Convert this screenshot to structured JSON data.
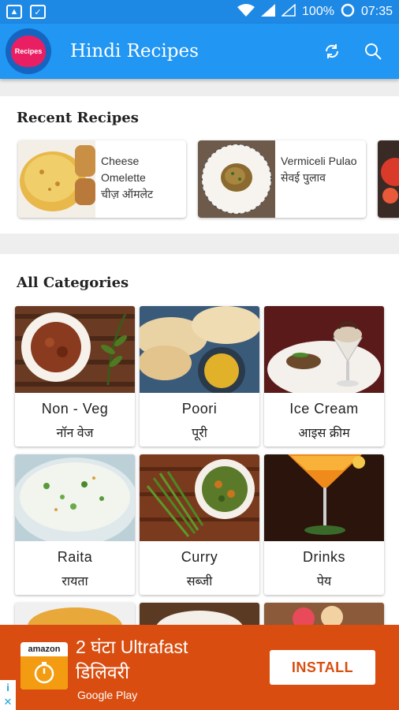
{
  "status_bar": {
    "battery": "100%",
    "time": "07:35"
  },
  "app_bar": {
    "title": "Hindi Recipes",
    "logo_text": "Recipes"
  },
  "recent": {
    "title": "Recent Recipes",
    "items": [
      {
        "name": "Cheese Omelette",
        "hindi": "चीज़ ऑमलेट"
      },
      {
        "name": "Vermiceli Pulao",
        "hindi": "सेवई पुलाव"
      }
    ]
  },
  "categories": {
    "title": "All Categories",
    "items": [
      {
        "name": "Non - Veg",
        "hindi": "नॉन वेज"
      },
      {
        "name": "Poori",
        "hindi": "पूरी"
      },
      {
        "name": "Ice Cream",
        "hindi": "आइस क्रीम"
      },
      {
        "name": "Raita",
        "hindi": "रायता"
      },
      {
        "name": "Curry",
        "hindi": "सब्जी"
      },
      {
        "name": "Drinks",
        "hindi": "पेय"
      }
    ]
  },
  "ad": {
    "brand": "amazon",
    "headline_line1": "2 घंटा Ultrafast",
    "headline_line2": "डिलिवरी",
    "store": "Google Play",
    "install_label": "INSTALL",
    "adchoices_i": "i",
    "adchoices_x": "✕"
  },
  "colors": {
    "primary": "#2196f3",
    "status_bar": "#1e88e5",
    "ad_bg": "#d94e10"
  }
}
